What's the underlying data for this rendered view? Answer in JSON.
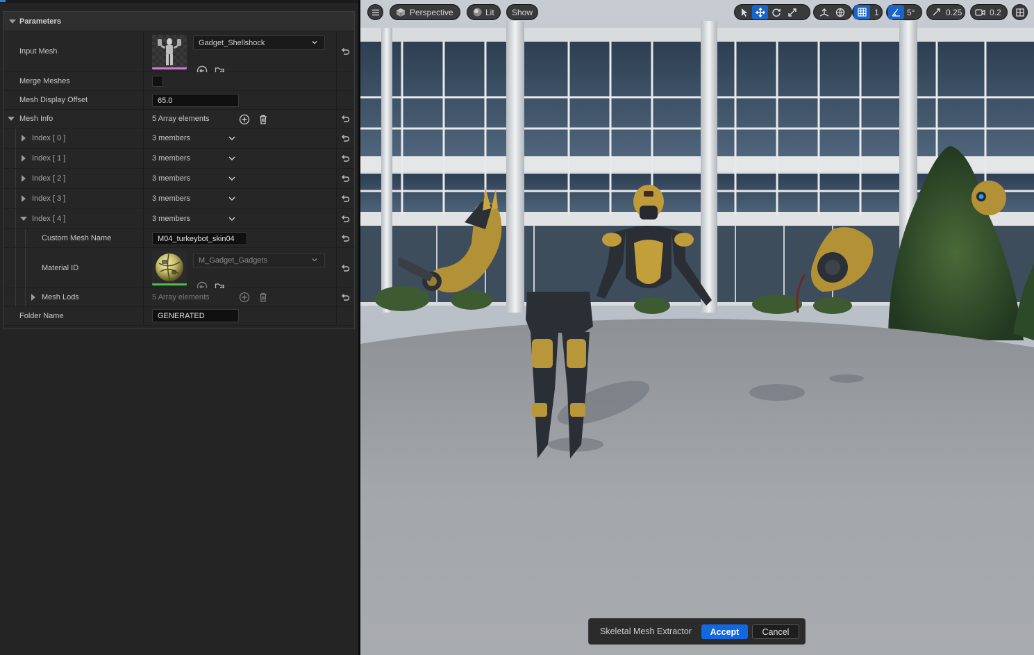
{
  "panel": {
    "category": "Parameters",
    "rows": {
      "input_mesh": {
        "label": "Input Mesh",
        "value": "Gadget_Shellshock"
      },
      "merge_meshes": {
        "label": "Merge Meshes",
        "checked": false
      },
      "mesh_display_offset": {
        "label": "Mesh Display Offset",
        "value": "65.0"
      },
      "mesh_info": {
        "label": "Mesh Info",
        "value": "5 Array elements"
      },
      "index0": {
        "label": "Index [ 0 ]",
        "value": "3 members"
      },
      "index1": {
        "label": "Index [ 1 ]",
        "value": "3 members"
      },
      "index2": {
        "label": "Index [ 2 ]",
        "value": "3 members"
      },
      "index3": {
        "label": "Index [ 3 ]",
        "value": "3 members"
      },
      "index4": {
        "label": "Index [ 4 ]",
        "value": "3 members"
      },
      "custom_mesh_name": {
        "label": "Custom Mesh Name",
        "value": "M04_turkeybot_skin04"
      },
      "material_id": {
        "label": "Material ID",
        "value": "M_Gadget_Gadgets"
      },
      "mesh_lods": {
        "label": "Mesh Lods",
        "value": "5 Array elements"
      },
      "folder_name": {
        "label": "Folder Name",
        "value": "GENERATED"
      }
    }
  },
  "viewport": {
    "toolbar": {
      "perspective": "Perspective",
      "lit": "Lit",
      "show": "Show",
      "grid_snap": "1",
      "rotation_snap": "5°",
      "scale_snap": "0.25",
      "camera_speed": "0.2"
    }
  },
  "dialog": {
    "title": "Skeletal Mesh Extractor",
    "accept": "Accept",
    "cancel": "Cancel"
  },
  "colors": {
    "accent": "#1168e0",
    "active_tool": "#1a64c8",
    "mesh_strip": "#d07ad8",
    "material_strip": "#4bc04b"
  }
}
